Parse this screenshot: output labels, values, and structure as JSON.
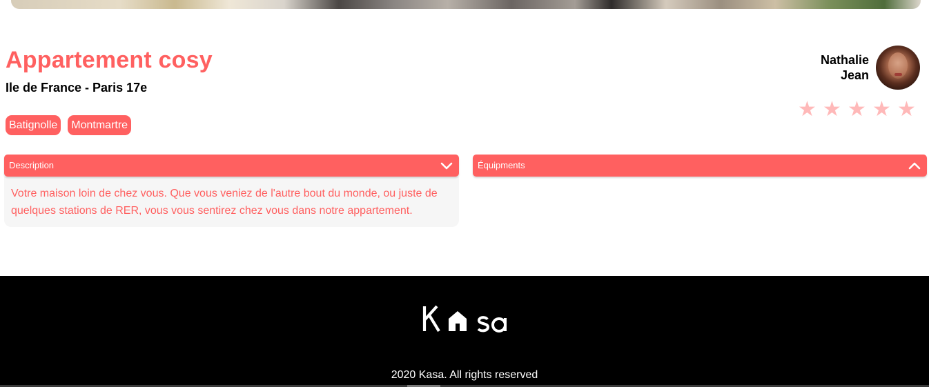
{
  "listing": {
    "title": "Appartement cosy",
    "location": "Ile de France - Paris 17e",
    "tags": [
      "Batignolle",
      "Montmartre"
    ],
    "rating": 5,
    "rating_max": 5
  },
  "host": {
    "first_name": "Nathalie",
    "last_name": "Jean"
  },
  "collapses": {
    "description": {
      "label": "Description",
      "text": "Votre maison loin de chez vous. Que vous veniez de l'autre bout du monde, ou juste de quelques stations de RER, vous vous sentirez chez vous dans notre appartement.",
      "state": "open"
    },
    "equipments": {
      "label": "Équipments",
      "state": "closed"
    }
  },
  "footer": {
    "logo": "Kasa",
    "copyright": "2020 Kasa. All rights reserved"
  },
  "colors": {
    "accent": "#FF6060",
    "star_active": "#FFB9B9",
    "footer_bg": "#000000"
  },
  "icons": {
    "star": "star-icon",
    "chevron_down": "chevron-down-icon",
    "chevron_up": "chevron-up-icon",
    "logo_house": "house-icon"
  }
}
